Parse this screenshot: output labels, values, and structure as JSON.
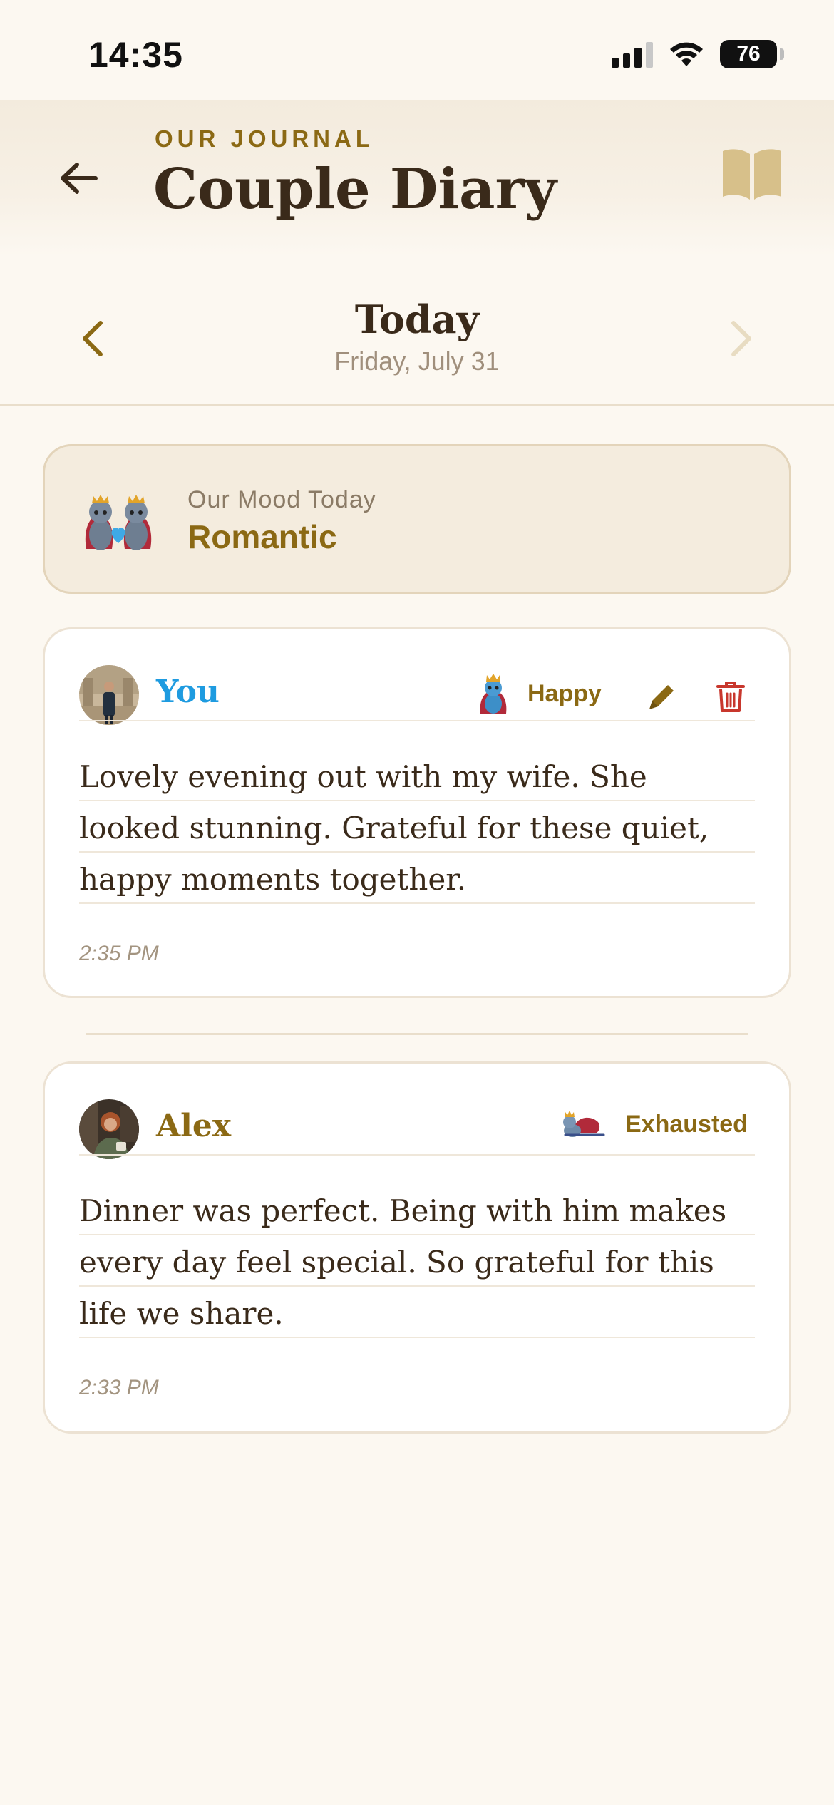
{
  "status_bar": {
    "time": "14:35",
    "battery": "76"
  },
  "header": {
    "eyebrow": "OUR JOURNAL",
    "title": "Couple Diary",
    "back_icon": "arrow-left-icon",
    "book_icon": "open-book-icon"
  },
  "date_nav": {
    "title": "Today",
    "subtitle": "Friday, July 31",
    "prev_icon": "chevron-left-icon",
    "next_icon": "chevron-right-icon"
  },
  "mood": {
    "label": "Our Mood Today",
    "value": "Romantic"
  },
  "entries": [
    {
      "author": "You",
      "mood": "Happy",
      "text": "Lovely evening out with my wife. She looked stunning. Grateful for these quiet, happy moments together.",
      "time": "2:35 PM",
      "author_color": "#1E9BE0"
    },
    {
      "author": "Alex",
      "mood": "Exhausted",
      "text": "Dinner was perfect. Being with him makes every day feel special. So grateful for this life we share.",
      "time": "2:33 PM",
      "author_color": "#8B6914"
    }
  ],
  "colors": {
    "background": "#FCF8F1",
    "accent": "#8B6914",
    "delete": "#C8372D",
    "text": "#3A2A1A"
  }
}
